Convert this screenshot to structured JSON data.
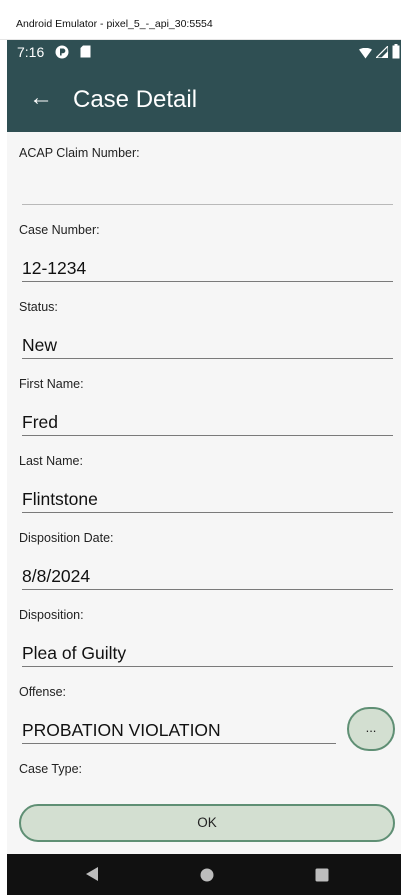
{
  "window": {
    "title": "Android Emulator - pixel_5_-_api_30:5554"
  },
  "status_bar": {
    "time": "7:16",
    "icons": [
      "assistant-icon",
      "sd-card-icon",
      "wifi-icon",
      "signal-icon",
      "battery-icon"
    ]
  },
  "app_bar": {
    "back_icon": "←",
    "title": "Case Detail"
  },
  "form": {
    "acap_claim": {
      "label": "ACAP Claim Number:",
      "value": ""
    },
    "case_number": {
      "label": "Case Number:",
      "value": "12-1234"
    },
    "status": {
      "label": "Status:",
      "value": "New"
    },
    "first_name": {
      "label": "First Name:",
      "value": "Fred"
    },
    "last_name": {
      "label": "Last Name:",
      "value": "Flintstone"
    },
    "disposition_date": {
      "label": "Disposition Date:",
      "value": "8/8/2024"
    },
    "disposition": {
      "label": "Disposition:",
      "value": "Plea of Guilty"
    },
    "offense": {
      "label": "Offense:",
      "value": "PROBATION VIOLATION",
      "button_label": "..."
    },
    "case_type": {
      "label": "Case Type:"
    }
  },
  "actions": {
    "ok_label": "OK"
  },
  "colors": {
    "app_bar": "#2f4f53",
    "content_bg": "#f6f6f6",
    "button_fill": "#d3dfd1",
    "button_border": "#5f8f74",
    "nav_bar": "#111111"
  },
  "nav_bar": {
    "icons": [
      "back-triangle-icon",
      "home-circle-icon",
      "recents-square-icon"
    ]
  }
}
